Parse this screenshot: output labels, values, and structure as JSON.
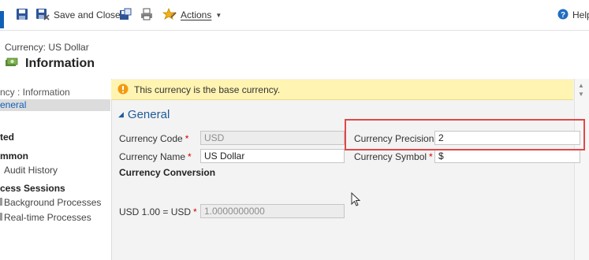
{
  "toolbar": {
    "save_and_close": "Save and Close",
    "actions": "Actions",
    "help": "Help"
  },
  "header": {
    "record_type": "Currency: US Dollar",
    "form_title": "Information"
  },
  "leftnav": {
    "form_link": "ncy : Information",
    "general": "eneral",
    "related_head": "ted",
    "common_head": "mmon",
    "audit_history": "Audit History",
    "process_head": "cess Sessions",
    "background": "Background Processes",
    "realtime": "Real-time Processes"
  },
  "notification": {
    "text": "This currency is the base currency."
  },
  "section": {
    "title": "General"
  },
  "fields": {
    "currency_code": {
      "label": "Currency Code",
      "value": "USD",
      "required": "*"
    },
    "currency_name": {
      "label": "Currency Name",
      "value": "US Dollar",
      "required": "*"
    },
    "currency_precision": {
      "label": "Currency Precision",
      "value": "2",
      "required": "*"
    },
    "currency_symbol": {
      "label": "Currency Symbol",
      "value": "$",
      "required": "*"
    },
    "conversion_heading": "Currency Conversion",
    "exchange_rate": {
      "label": "USD 1.00 = USD",
      "value": "1.0000000000",
      "required": "*"
    }
  },
  "colors": {
    "accent": "#1160b7",
    "section_title": "#1d5a9a",
    "notification_bg": "#fff4b1",
    "highlight": "#e04848",
    "required": "#d10000"
  }
}
